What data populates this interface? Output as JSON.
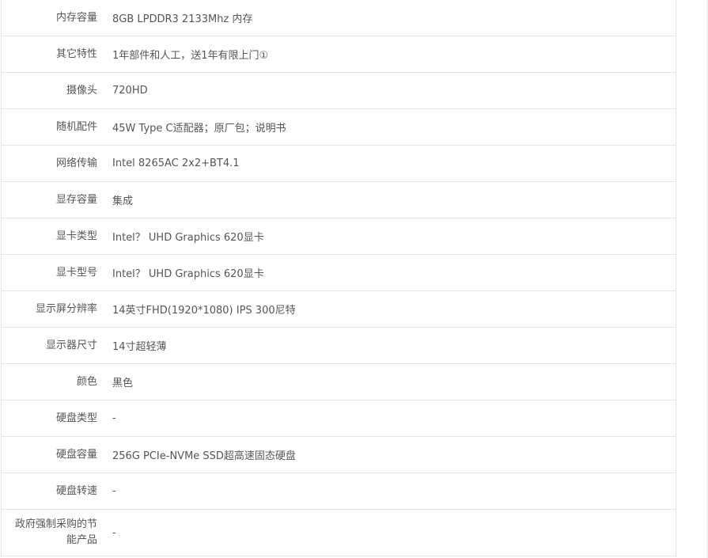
{
  "specs": [
    {
      "key": "内存容量",
      "value": "8GB LPDDR3 2133Mhz 内存"
    },
    {
      "key": "其它特性",
      "value": "1年部件和人工，送1年有限上门①"
    },
    {
      "key": "摄像头",
      "value": "720HD"
    },
    {
      "key": "随机配件",
      "value": "45W Type C适配器；原厂包；说明书"
    },
    {
      "key": "网络传输",
      "value": "Intel 8265AC 2x2+BT4.1"
    },
    {
      "key": "显存容量",
      "value": "集成"
    },
    {
      "key": "显卡类型",
      "value": "Intel？ UHD Graphics 620显卡"
    },
    {
      "key": "显卡型号",
      "value": "Intel？ UHD Graphics 620显卡"
    },
    {
      "key": "显示屏分辨率",
      "value": "14英寸FHD(1920*1080) IPS 300尼特"
    },
    {
      "key": "显示器尺寸",
      "value": "14寸超轻薄"
    },
    {
      "key": "颜色",
      "value": "黑色"
    },
    {
      "key": "硬盘类型",
      "value": "-"
    },
    {
      "key": "硬盘容量",
      "value": "256G PCIe-NVMe SSD超高速固态硬盘"
    },
    {
      "key": "硬盘转速",
      "value": "-"
    },
    {
      "key": "政府强制采购的节能产品",
      "value": "-"
    }
  ]
}
